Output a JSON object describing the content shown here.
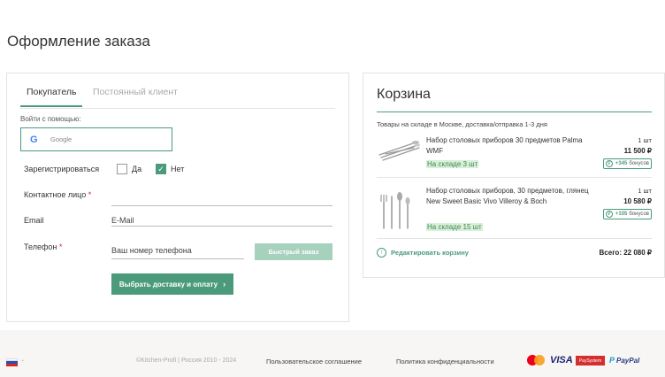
{
  "page_title": "Оформление заказа",
  "buyer": {
    "tabs": [
      "Покупатель",
      "Постоянный клиент"
    ],
    "login_label": "Войти с помощью:",
    "google_label": "Google",
    "register_label": "Зарегистрироваться",
    "register_yes": "Да",
    "register_no": "Нет",
    "register_selected": "Нет",
    "contact_label": "Контактное лицо",
    "contact_value": "",
    "email_label": "Email",
    "email_placeholder": "E-Mail",
    "phone_label": "Телефон",
    "phone_placeholder": "Ваш номер телефона",
    "required_mark": "*",
    "quick_order_label": "Быстрый заказ",
    "select_delivery_label": "Выбрать доставку и оплату",
    "select_delivery_arrow": "›"
  },
  "cart": {
    "title": "Корзина",
    "stock_note": "Товары на складе в Москве, доставка/отправка 1-3 дня",
    "items": [
      {
        "name": "Набор столовых приборов 30 предметов Palma WMF",
        "stock": "На складе 3 шт",
        "qty": "1 шт",
        "price": "11 500 ₽",
        "bonus_amount": "+345",
        "bonus_label": "бонусов"
      },
      {
        "name": "Набор столовых приборов, 30 предметов, глянец New Sweet Basic Vivo Villeroy & Boch",
        "stock": "На складе 15 шт",
        "qty": "1 шт",
        "price": "10 580 ₽",
        "bonus_amount": "+105",
        "bonus_label": "бонусов"
      }
    ],
    "edit_label": "Редактировать корзину",
    "total": "Всего: 22 080 ₽"
  },
  "footer": {
    "copyright": "©Kitchen-Profi | Россия 2010 - 2024",
    "links": [
      "Пользовательское соглашение",
      "Политика конфиденциальности"
    ],
    "payments": {
      "visa": "VISA",
      "paysystem": "PaySystem",
      "paypal_p": "P",
      "paypal": "PayPal"
    }
  },
  "colors": {
    "accent": "#4a9a7b",
    "accent_light": "#a6d1bc",
    "stock_bg": "#d9efd9",
    "required": "#dd2233"
  }
}
